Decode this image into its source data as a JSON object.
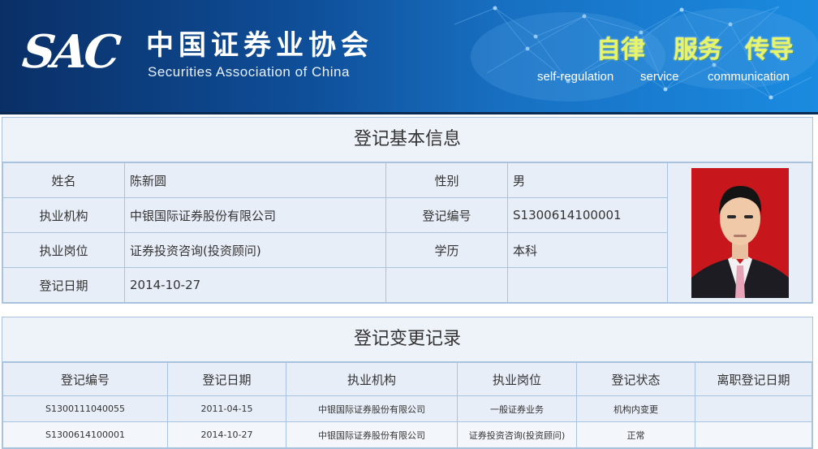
{
  "header": {
    "logo_mark": "SAC",
    "org_name_cn": "中国证券业协会",
    "org_name_en": "Securities Association of China",
    "slogans": [
      {
        "cn": "自律",
        "en": "self-regulation"
      },
      {
        "cn": "服务",
        "en": "service"
      },
      {
        "cn": "传导",
        "en": "communication"
      }
    ]
  },
  "basic_info": {
    "title": "登记基本信息",
    "name_label": "姓名",
    "name": "陈新圆",
    "gender_label": "性别",
    "gender": "男",
    "org_label": "执业机构",
    "org": "中银国际证券股份有限公司",
    "reg_no_label": "登记编号",
    "reg_no": "S1300614100001",
    "position_label": "执业岗位",
    "position": "证券投资咨询(投资顾问)",
    "education_label": "学历",
    "education": "本科",
    "reg_date_label": "登记日期",
    "reg_date": "2014-10-27",
    "photo": "person-photo"
  },
  "change_records": {
    "title": "登记变更记录",
    "columns": [
      "登记编号",
      "登记日期",
      "执业机构",
      "执业岗位",
      "登记状态",
      "离职登记日期"
    ],
    "rows": [
      [
        "S1300111040055",
        "2011-04-15",
        "中银国际证券股份有限公司",
        "一般证券业务",
        "机构内变更",
        ""
      ],
      [
        "S1300614100001",
        "2014-10-27",
        "中银国际证券股份有限公司",
        "证券投资咨询(投资顾问)",
        "正常",
        ""
      ]
    ]
  }
}
